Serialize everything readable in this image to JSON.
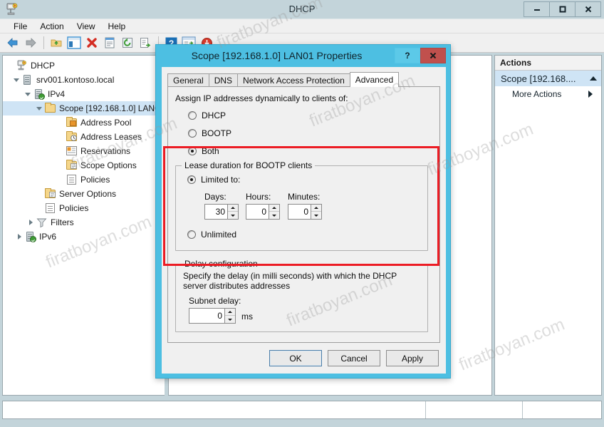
{
  "window": {
    "title": "DHCP",
    "app_icon": "dhcp-icon",
    "controls": {
      "minimize": "–",
      "maximize": "❑",
      "close": "✕"
    }
  },
  "menubar": {
    "items": [
      {
        "label": "File"
      },
      {
        "label": "Action"
      },
      {
        "label": "View"
      },
      {
        "label": "Help"
      }
    ]
  },
  "toolbar": {
    "items": [
      {
        "name": "back-icon"
      },
      {
        "name": "forward-icon"
      },
      {
        "name": "up-folder-icon"
      },
      {
        "name": "show-hide-tree-icon"
      },
      {
        "name": "delete-icon"
      },
      {
        "name": "properties-icon"
      },
      {
        "name": "refresh-icon"
      },
      {
        "name": "export-list-icon"
      },
      {
        "name": "help-icon"
      },
      {
        "name": "console-icon"
      },
      {
        "name": "download-icon"
      }
    ]
  },
  "tree": {
    "nodes": [
      {
        "label": "DHCP",
        "depth": 0,
        "icon": "dhcp-icon",
        "twisty": "none",
        "selected": false
      },
      {
        "label": "srv001.kontoso.local",
        "depth": 1,
        "icon": "server-icon",
        "twisty": "open",
        "selected": false
      },
      {
        "label": "IPv4",
        "depth": 2,
        "icon": "server-ok-icon",
        "twisty": "open",
        "selected": false
      },
      {
        "label": "Scope [192.168.1.0] LAN01",
        "depth": 3,
        "icon": "folder-icon",
        "twisty": "open",
        "selected": true
      },
      {
        "label": "Address Pool",
        "depth": 4,
        "icon": "address-pool-icon",
        "twisty": "none",
        "selected": false
      },
      {
        "label": "Address Leases",
        "depth": 4,
        "icon": "address-leases-icon",
        "twisty": "none",
        "selected": false
      },
      {
        "label": "Reservations",
        "depth": 4,
        "icon": "reservations-icon",
        "twisty": "none",
        "selected": false
      },
      {
        "label": "Scope Options",
        "depth": 4,
        "icon": "scope-options-icon",
        "twisty": "none",
        "selected": false
      },
      {
        "label": "Policies",
        "depth": 4,
        "icon": "policies-icon",
        "twisty": "none",
        "selected": false
      },
      {
        "label": "Server Options",
        "depth": 3,
        "icon": "server-options-icon",
        "twisty": "none",
        "selected": false
      },
      {
        "label": "Policies",
        "depth": 3,
        "icon": "policies-icon",
        "twisty": "none",
        "selected": false
      },
      {
        "label": "Filters",
        "depth": 3,
        "icon": "filter-icon",
        "twisty": "closed",
        "selected": false
      },
      {
        "label": "IPv6",
        "depth": 2,
        "icon": "server-ok-icon",
        "twisty": "closed",
        "selected": false
      }
    ]
  },
  "actions": {
    "header": "Actions",
    "group_label": "Scope [192.168....",
    "more_actions": "More Actions"
  },
  "dialog": {
    "title": "Scope [192.168.1.0] LAN01 Properties",
    "help_button": "?",
    "close_button": "✕",
    "tabs": [
      {
        "label": "General",
        "active": false
      },
      {
        "label": "DNS",
        "active": false
      },
      {
        "label": "Network Access Protection",
        "active": false
      },
      {
        "label": "Advanced",
        "active": true
      }
    ],
    "assign_label": "Assign IP addresses dynamically to clients of:",
    "assign_options": [
      {
        "label": "DHCP",
        "selected": false
      },
      {
        "label": "BOOTP",
        "selected": false
      },
      {
        "label": "Both",
        "selected": true
      }
    ],
    "lease_group": {
      "title": "Lease duration for BOOTP clients",
      "limited_label": "Limited to:",
      "limited_selected": true,
      "fields": [
        {
          "label": "Days:",
          "value": "30"
        },
        {
          "label": "Hours:",
          "value": "0"
        },
        {
          "label": "Minutes:",
          "value": "0"
        }
      ],
      "unlimited_label": "Unlimited",
      "unlimited_selected": false
    },
    "delay_group": {
      "title": "Delay configuration",
      "description": "Specify the delay (in milli seconds) with which the DHCP server distributes addresses",
      "subnet_delay_label": "Subnet delay:",
      "subnet_delay_value": "0",
      "unit": "ms"
    },
    "buttons": {
      "ok": "OK",
      "cancel": "Cancel",
      "apply": "Apply"
    }
  },
  "annotation": {
    "highlight_color": "#ec1c24"
  },
  "watermark": {
    "text": "firatboyan.com"
  },
  "colors": {
    "window_chrome": "#c3d4da",
    "dialog_titlebar": "#4dbfe2",
    "selection": "#cfe4f5",
    "close_red": "#c0504d"
  }
}
